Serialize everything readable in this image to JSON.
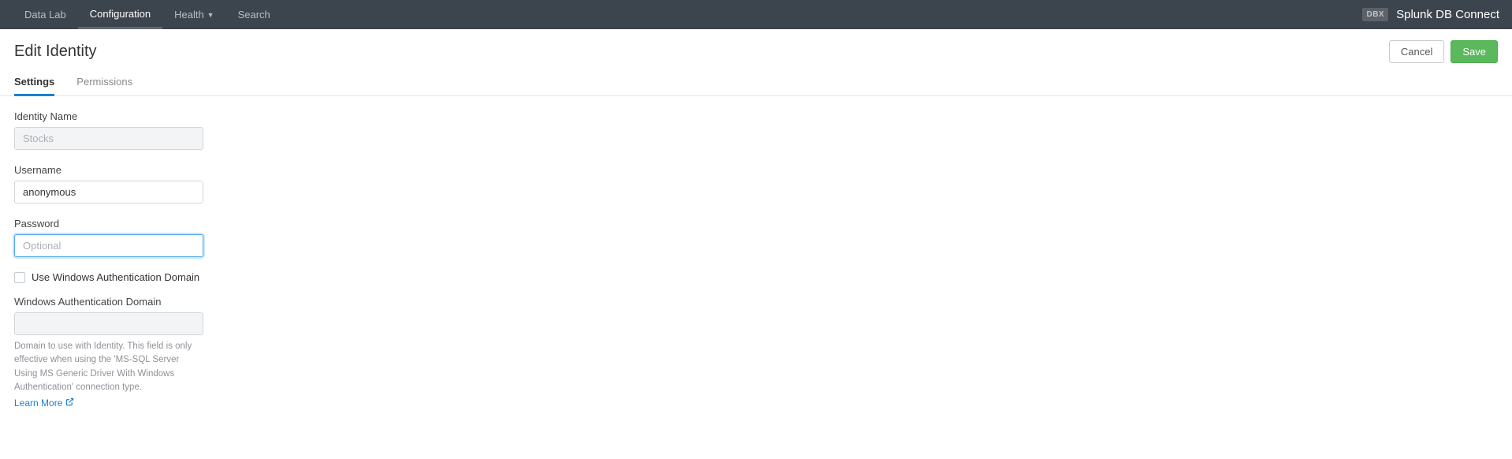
{
  "topnav": {
    "items": [
      {
        "label": "Data Lab"
      },
      {
        "label": "Configuration"
      },
      {
        "label": "Health"
      },
      {
        "label": "Search"
      }
    ],
    "badge": "DBX",
    "app_name": "Splunk DB Connect"
  },
  "header": {
    "title": "Edit Identity",
    "cancel_label": "Cancel",
    "save_label": "Save"
  },
  "tabs": {
    "settings": "Settings",
    "permissions": "Permissions"
  },
  "form": {
    "identity_name_label": "Identity Name",
    "identity_name_value": "Stocks",
    "username_label": "Username",
    "username_value": "anonymous",
    "password_label": "Password",
    "password_placeholder": "Optional",
    "win_auth_checkbox_label": "Use Windows Authentication Domain",
    "win_auth_domain_label": "Windows Authentication Domain",
    "win_auth_help": "Domain to use with Identity. This field is only effective when using the 'MS-SQL Server Using MS Generic Driver With Windows Authentication' connection type.",
    "learn_more": "Learn More"
  }
}
